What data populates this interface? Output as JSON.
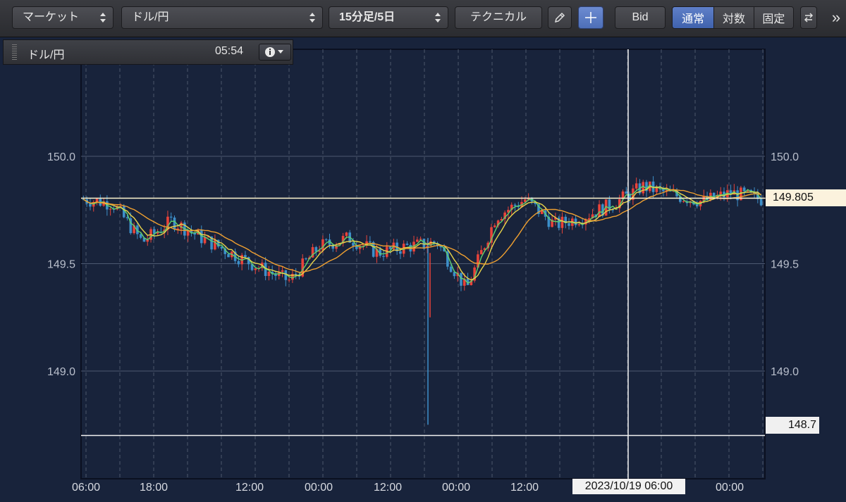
{
  "toolbar": {
    "market_select": "マーケット",
    "pair_select": "ドル/円",
    "period_select": "15分足/5日",
    "technical_button": "テクニカル",
    "bid_button": "Bid",
    "scale_modes": [
      "通常",
      "対数",
      "固定"
    ],
    "scale_active": "通常",
    "more": "»"
  },
  "infobar": {
    "symbol": "ドル/円",
    "time": "05:54"
  },
  "crosshair": {
    "date_label": "2023/10/19 06:00",
    "price_label": "148.7"
  },
  "last_price_label": "149.805",
  "colors": {
    "background": "#18233b",
    "grid": "#5a6478",
    "candle_up": "#e8433a",
    "candle_down": "#3d8fc9",
    "ma_short": "#5fd16e",
    "ma_mid": "#e9d44a",
    "ma_long": "#f0a030",
    "price_line": "#fff6cf"
  },
  "chart_data": {
    "type": "candlestick",
    "title": "ドル/円",
    "ylim": [
      148.45,
      150.5
    ],
    "y_ticks": [
      "150.0",
      "149.5",
      "149.0"
    ],
    "x_tick_labels": [
      "06:00",
      "18:00",
      "12:00",
      "00:00",
      "12:00",
      "00:00",
      "12:00",
      "00:00"
    ],
    "last_price": 149.805,
    "crosshair_price": 148.7,
    "series": [
      {
        "name": "ドル/円",
        "approx_close_path": [
          {
            "t": "06:00",
            "close": 149.8
          },
          {
            "t": "10:00",
            "close": 149.78
          },
          {
            "t": "14:00",
            "close": 149.6
          },
          {
            "t": "18:00",
            "close": 149.7
          },
          {
            "t": "00:00",
            "close": 149.62
          },
          {
            "t": "06:00",
            "close": 149.55
          },
          {
            "t": "12:00",
            "close": 149.48
          },
          {
            "t": "18:00",
            "close": 149.42
          },
          {
            "t": "00:00",
            "close": 149.58
          },
          {
            "t": "06:00",
            "close": 149.62
          },
          {
            "t": "12:00",
            "close": 149.55
          },
          {
            "t": "18:00",
            "close": 149.58
          },
          {
            "t": "21:00",
            "close": 149.6
          },
          {
            "t": "22:30",
            "close": 149.38
          },
          {
            "t": "00:00",
            "close": 149.72
          },
          {
            "t": "06:00",
            "close": 149.8
          },
          {
            "t": "12:00",
            "close": 149.68
          },
          {
            "t": "18:00",
            "close": 149.72
          },
          {
            "t": "00:00",
            "close": 149.78
          },
          {
            "t": "06:00",
            "close": 149.86
          },
          {
            "t": "12:00",
            "close": 149.82
          },
          {
            "t": "18:00",
            "close": 149.79
          },
          {
            "t": "00:00",
            "close": 149.83
          },
          {
            "t": "04:00",
            "close": 149.8
          }
        ]
      }
    ],
    "extremes": {
      "spike_low": 148.75,
      "high": 149.95,
      "low_pre_spike": 149.38
    }
  }
}
